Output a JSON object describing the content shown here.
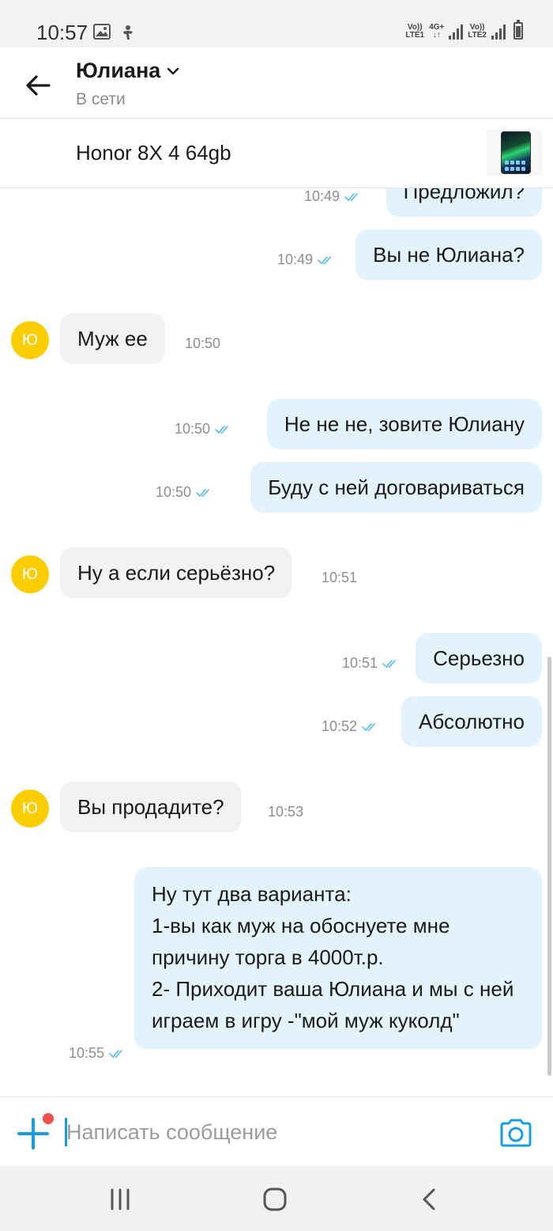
{
  "status_bar": {
    "time": "10:57",
    "sim1_top": "Vo))",
    "sim1_bottom": "LTE1",
    "net_top": "4G+",
    "net_bottom": "↓↑",
    "sim2_top": "Vo))",
    "sim2_bottom": "LTE2"
  },
  "header": {
    "contact_name": "Юлиана",
    "contact_status": "В сети"
  },
  "product": {
    "title": "Honor 8X 4 64gb"
  },
  "messages": [
    {
      "dir": "out",
      "text": "Предложил?",
      "time": "10:49"
    },
    {
      "dir": "out",
      "text": "Вы не Юлиана?",
      "time": "10:49"
    },
    {
      "dir": "in",
      "avatar": "Ю",
      "text": "Муж ее",
      "time": "10:50"
    },
    {
      "dir": "out",
      "text": "Не не не, зовите Юлиану",
      "time": "10:50"
    },
    {
      "dir": "out",
      "text": "Буду с ней договариваться",
      "time": "10:50"
    },
    {
      "dir": "in",
      "avatar": "Ю",
      "text": "Ну а если серьёзно?",
      "time": "10:51"
    },
    {
      "dir": "out",
      "text": "Серьезно",
      "time": "10:51"
    },
    {
      "dir": "out",
      "text": "Абсолютно",
      "time": "10:52"
    },
    {
      "dir": "in",
      "avatar": "Ю",
      "text": "Вы продадите?",
      "time": "10:53"
    },
    {
      "dir": "out",
      "lines": [
        "Ну тут два варианта:",
        "1-вы как муж на обоснуете мне причину торга в 4000т.р.",
        "2- Приходит ваша Юлиана и мы с ней  играем в игру -\"мой муж куколд\""
      ],
      "time": "10:55"
    }
  ],
  "composer": {
    "placeholder": "Написать сообщение"
  },
  "colors": {
    "outgoing_bubble": "#e3f3fb",
    "incoming_bubble": "#f2f2f2",
    "avatar": "#fccd00",
    "accent": "#1a9de0",
    "notification_dot": "#f0504c"
  },
  "icons": [
    "back-arrow-icon",
    "chevron-down-icon",
    "double-check-icon",
    "plus-icon",
    "camera-icon",
    "recent-apps-icon",
    "home-icon",
    "back-icon"
  ]
}
